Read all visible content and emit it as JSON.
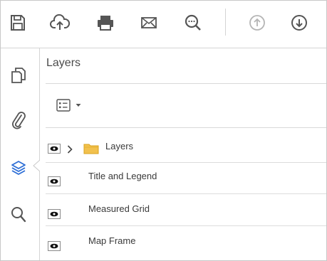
{
  "toolbar": {
    "icons": [
      "save-icon",
      "cloud-upload-icon",
      "print-icon",
      "email-icon",
      "search-zoom-icon",
      "previous-page-icon",
      "next-page-icon"
    ]
  },
  "rail": {
    "icons": [
      "pages-icon",
      "attachments-icon",
      "layers-icon",
      "search-icon"
    ],
    "active": "layers-icon",
    "accent": "#2d6ed6"
  },
  "panel": {
    "title": "Layers",
    "layers": [
      {
        "label": "Layers",
        "visible": true,
        "type": "folder",
        "collapsed": true
      },
      {
        "label": "Title and Legend",
        "visible": true,
        "type": "layer"
      },
      {
        "label": "Measured Grid",
        "visible": true,
        "type": "layer"
      },
      {
        "label": "Map Frame",
        "visible": true,
        "type": "layer"
      }
    ]
  },
  "colors": {
    "icon": "#555555",
    "disabled": "#b5b5b5",
    "folder": "#f2c14e"
  }
}
